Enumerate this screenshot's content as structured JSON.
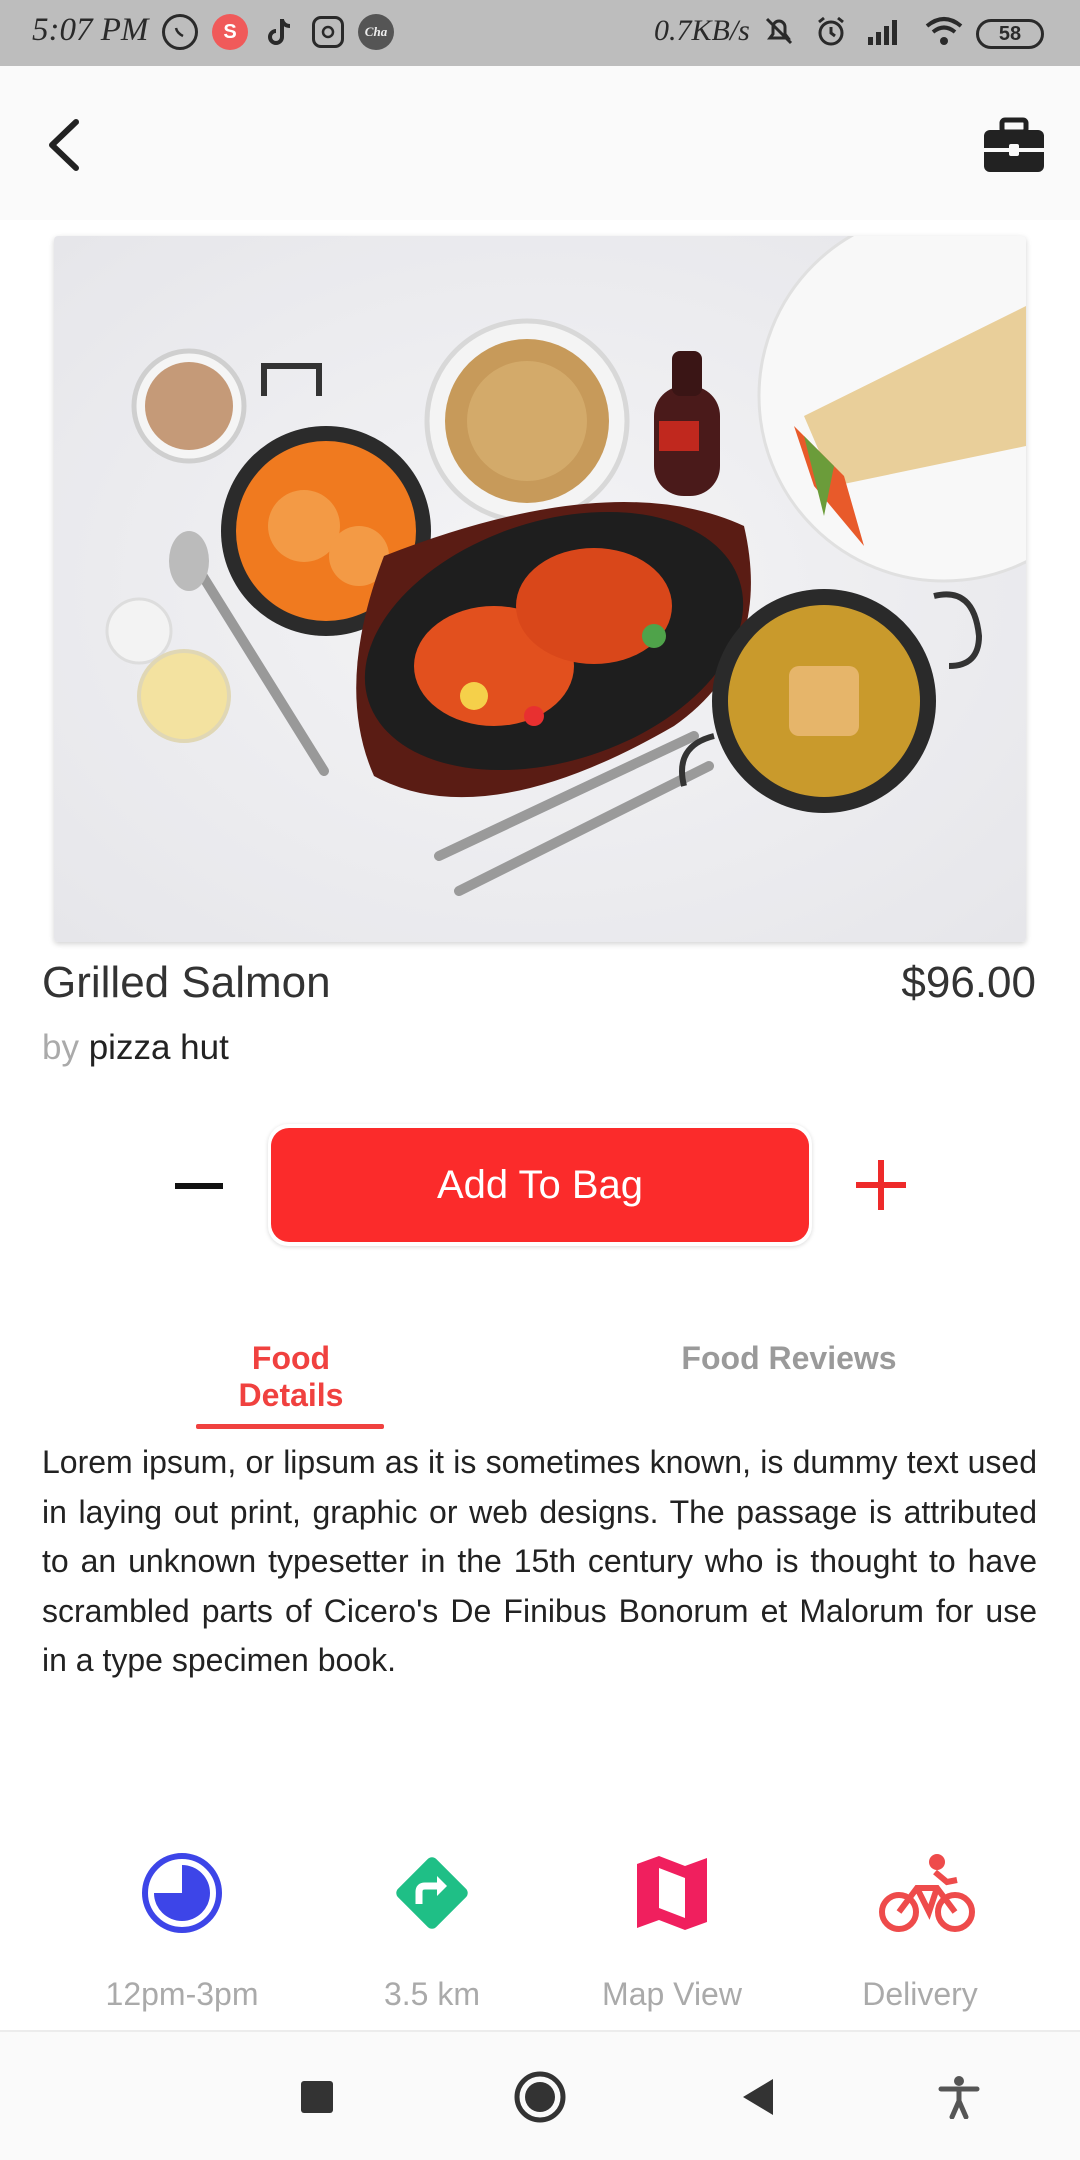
{
  "status_bar": {
    "time": "5:07 PM",
    "network_speed": "0.7KB/s",
    "battery": "58",
    "left_icons": [
      "whatsapp-icon",
      "s-app-icon",
      "tiktok-icon",
      "instagram-icon",
      "chatime-icon"
    ],
    "right_icons": [
      "mute-icon",
      "alarm-icon",
      "signal-icon",
      "wifi-icon",
      "battery-icon"
    ]
  },
  "app_bar": {
    "back_icon": "chevron-left-icon",
    "bag_icon": "briefcase-icon"
  },
  "product": {
    "name": "Grilled Salmon",
    "price": "$96.00",
    "by_label": "by",
    "vendor": "pizza hut"
  },
  "actions": {
    "add_to_bag": "Add To Bag"
  },
  "tabs": [
    {
      "label": "Food Details",
      "active": true
    },
    {
      "label": "Food Reviews",
      "active": false
    }
  ],
  "description": "Lorem ipsum, or lipsum as it is sometimes known, is dummy text used in laying out print, graphic or web designs. The passage is attributed to an unknown typesetter in the 15th century who is thought to have scrambled parts of Cicero's De Finibus Bonorum et Malorum for use in a type specimen book.",
  "info": [
    {
      "label": "12pm-3pm",
      "icon": "clock-icon",
      "color": "#3d45e8"
    },
    {
      "label": "3.5 km",
      "icon": "directions-icon",
      "color": "#1fbf86"
    },
    {
      "label": "Map View",
      "icon": "map-icon",
      "color": "#f01f5e"
    },
    {
      "label": "Delivery",
      "icon": "bicycle-icon",
      "color": "#ee4b4b"
    }
  ],
  "colors": {
    "accent": "#f0413f",
    "button": "#fb2b2b"
  }
}
